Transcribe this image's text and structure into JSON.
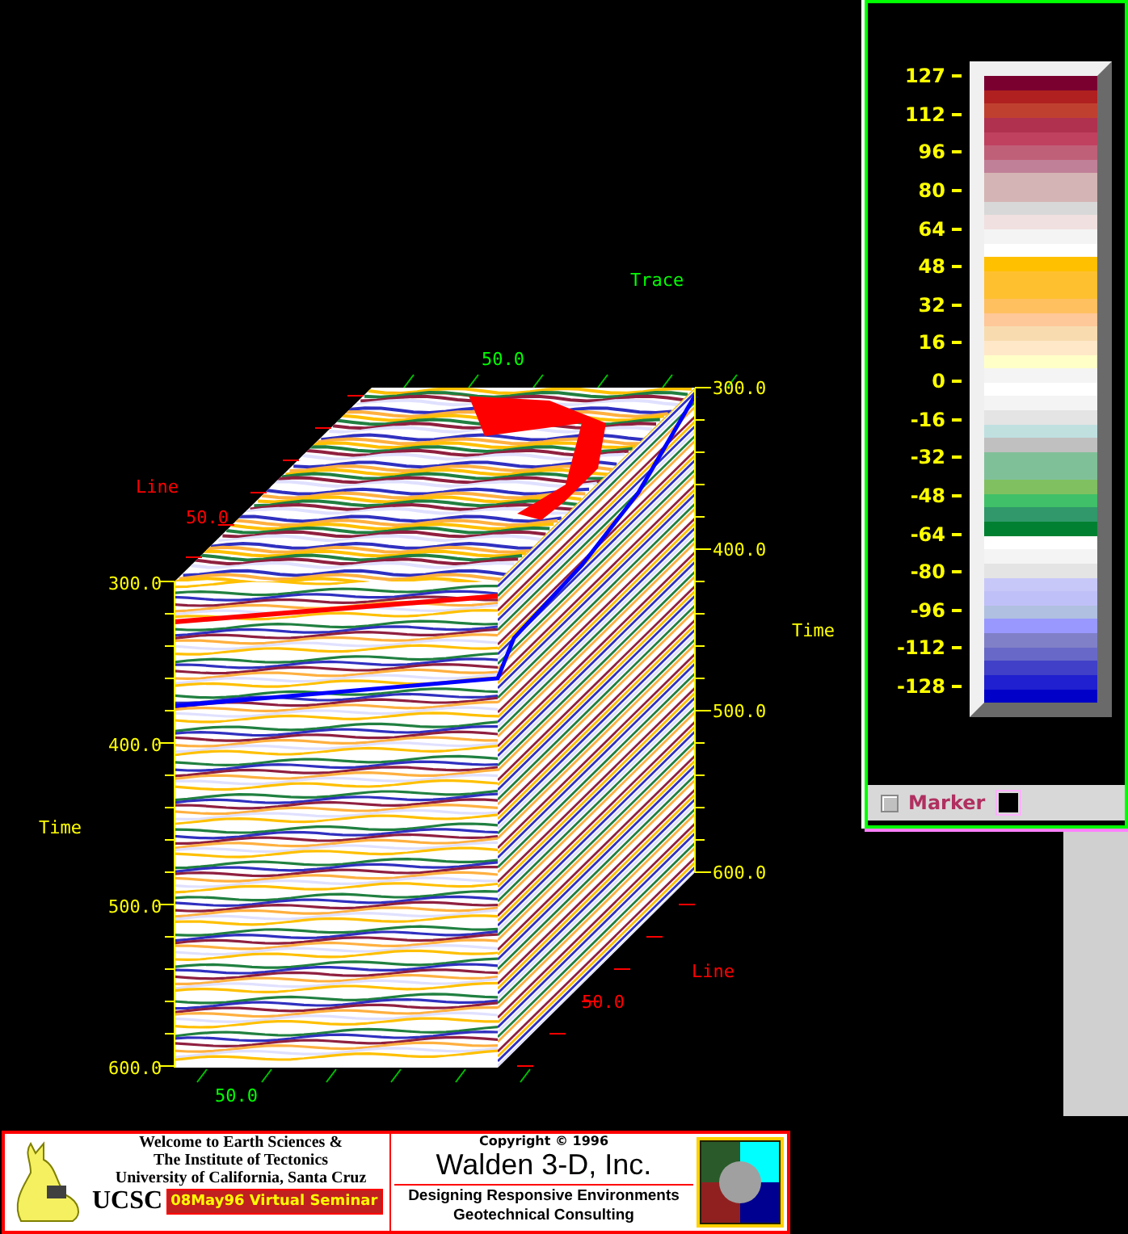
{
  "viewer": {
    "trace_axis": {
      "title": "Trace",
      "tick_label": "50.0"
    },
    "line_axis": {
      "title": "Line",
      "tick_label": "50.0"
    },
    "time_axis_left": {
      "title": "Time",
      "tick_labels": [
        "300.0",
        "400.0",
        "500.0",
        "600.0"
      ]
    },
    "time_axis_right": {
      "title": "Time",
      "tick_labels": [
        "300.0",
        "400.0",
        "500.0",
        "600.0"
      ]
    },
    "line_axis_lower": {
      "title": "Line",
      "tick_label": "50.0"
    },
    "trace_axis_lower": {
      "tick_label": "50.0"
    }
  },
  "colorbar": {
    "tick_labels": [
      "127",
      "112",
      "96",
      "80",
      "64",
      "48",
      "32",
      "16",
      "0",
      "-16",
      "-32",
      "-48",
      "-64",
      "-80",
      "-96",
      "-112",
      "-128"
    ],
    "bands": [
      {
        "color": "#7a0030"
      },
      {
        "color": "#b02020"
      },
      {
        "color": "#c04030"
      },
      {
        "color": "#b03050"
      },
      {
        "color": "#c04060"
      },
      {
        "color": "#c06078"
      },
      {
        "color": "#c08098"
      },
      {
        "color": "#d4b4b4"
      },
      {
        "color": "#d4b4b4"
      },
      {
        "color": "#d8d8d8"
      },
      {
        "color": "#f0e0e0"
      },
      {
        "color": "#f4f4f4"
      },
      {
        "color": "#ffffff"
      },
      {
        "color": "#ffc000"
      },
      {
        "color": "#ffc030"
      },
      {
        "color": "#ffc030"
      },
      {
        "color": "#ffc060"
      },
      {
        "color": "#ffc898"
      },
      {
        "color": "#f8dcb0"
      },
      {
        "color": "#ffe8c8"
      },
      {
        "color": "#ffffc8"
      },
      {
        "color": "#f4f4f4"
      },
      {
        "color": "#ffffff"
      },
      {
        "color": "#f4f4f4"
      },
      {
        "color": "#e4e4e4"
      },
      {
        "color": "#c0e0e0"
      },
      {
        "color": "#c0c0c0"
      },
      {
        "color": "#80c098"
      },
      {
        "color": "#80c098"
      },
      {
        "color": "#80c060"
      },
      {
        "color": "#40c068"
      },
      {
        "color": "#30986a"
      },
      {
        "color": "#008030"
      },
      {
        "color": "#ffffff"
      },
      {
        "color": "#f4f4f4"
      },
      {
        "color": "#e4e4e4"
      },
      {
        "color": "#c8c8f8"
      },
      {
        "color": "#c0c0f8"
      },
      {
        "color": "#b0c0e0"
      },
      {
        "color": "#9898ff"
      },
      {
        "color": "#8080c8"
      },
      {
        "color": "#6868c8"
      },
      {
        "color": "#4040c8"
      },
      {
        "color": "#2020d0"
      },
      {
        "color": "#0000c8"
      }
    ]
  },
  "marker": {
    "checked": false,
    "label": "Marker",
    "color": "#000000"
  },
  "banner": {
    "welcome_lines": [
      "Welcome to Earth Sciences &",
      "The Institute of Tectonics",
      "University of California, Santa Cruz"
    ],
    "logo_text": "UCSC",
    "seminar": "08May96 Virtual Seminar",
    "copyright": "Copyright © 1996",
    "company": "Walden 3-D, Inc.",
    "tagline_lines": [
      "Designing Responsive Environments",
      "Geotechnical Consulting"
    ]
  }
}
